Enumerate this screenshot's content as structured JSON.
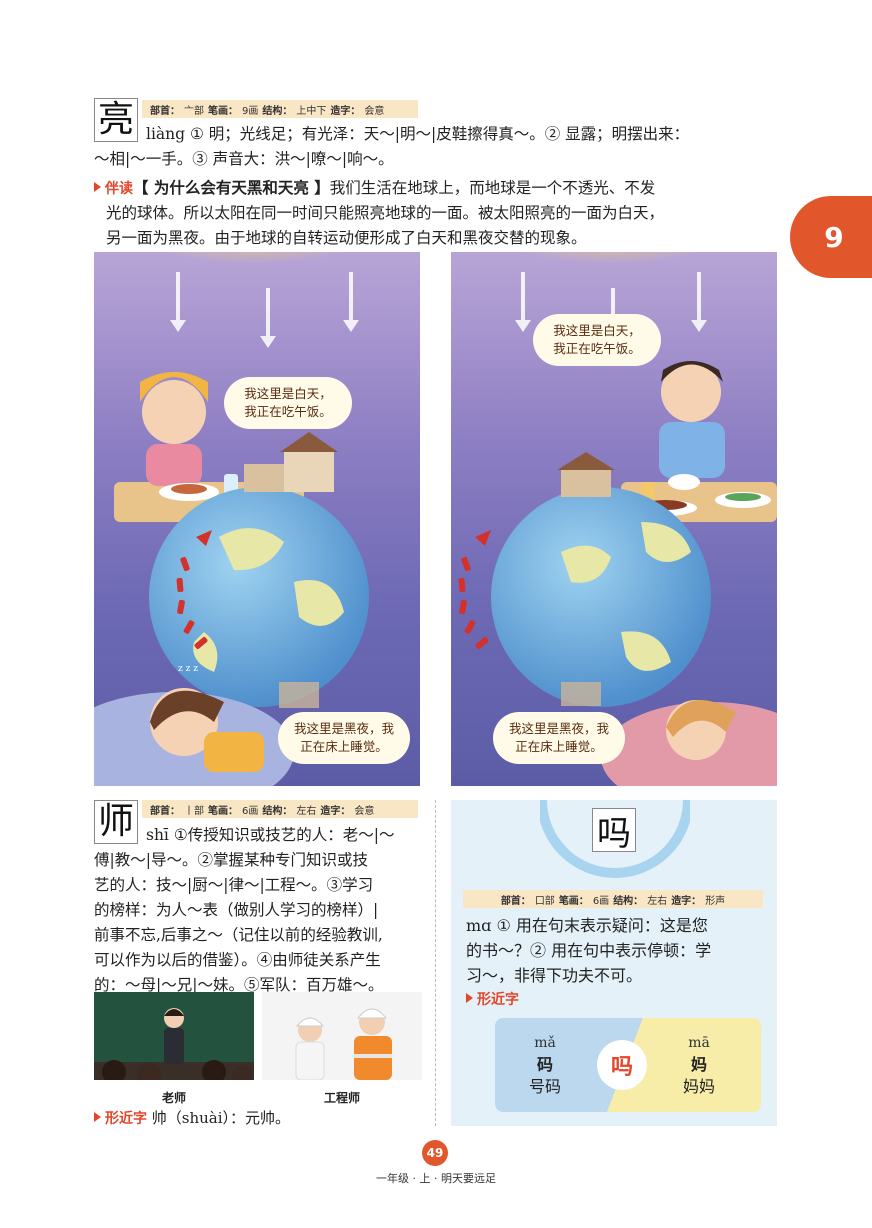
{
  "entries": {
    "liang": {
      "char": "亮",
      "meta": {
        "radical_label": "部首：",
        "radical": "亠部",
        "strokes_label": "笔画：",
        "strokes": "9画",
        "structure_label": "结构：",
        "structure": "上中下",
        "formation_label": "造字：",
        "formation": "会意"
      },
      "line1": "liàng ① 明；光线足；有光泽：天～|明～|皮鞋擦得真～。② 显露；明摆出来：",
      "line2": "～相|～一手。③ 声音大：洪～|嘹～|响～。"
    },
    "shi": {
      "char": "师",
      "meta": {
        "radical_label": "部首：",
        "radical": "丨部",
        "strokes_label": "笔画：",
        "strokes": "6画",
        "structure_label": "结构：",
        "structure": "左右",
        "formation_label": "造字：",
        "formation": "会意"
      },
      "lines": [
        "shī ①传授知识或技艺的人：老～|～",
        "傅|教～|导～。②掌握某种专门知识或技",
        "艺的人：技～|厨～|律～|工程～。③学习",
        "的榜样：为人～表（做别人学习的榜样）|",
        "前事不忘,后事之～（记住以前的经验教训,",
        "可以作为以后的借鉴）。④由师徒关系产生",
        "的：～母|～兄|～妹。⑤军队：百万雄～。"
      ],
      "photos": [
        {
          "caption": "老师"
        },
        {
          "caption": "工程师"
        }
      ],
      "similar_label": "形近字",
      "similar_text": "帅（shuài）：元帅。"
    },
    "ma": {
      "char": "吗",
      "meta": {
        "radical_label": "部首：",
        "radical": "口部",
        "strokes_label": "笔画：",
        "strokes": "6画",
        "structure_label": "结构：",
        "structure": "左右",
        "formation_label": "造字：",
        "formation": "形声"
      },
      "lines": [
        "mɑ ① 用在句末表示疑问：这是您",
        "的书～？② 用在句中表示停顿：学",
        "习～，非得下功夫不可。"
      ],
      "similar_label": "形近字",
      "compare": {
        "left": {
          "pinyin": "mǎ",
          "char": "码",
          "word": "号码"
        },
        "center": "吗",
        "right": {
          "pinyin": "mā",
          "char": "妈",
          "word": "妈妈"
        }
      }
    }
  },
  "reading": {
    "label": "伴读",
    "title": "【 为什么会有天黑和天亮 】",
    "line1_rest": "我们生活在地球上，而地球是一个不透光、不发",
    "line2": "光的球体。所以太阳在同一时间只能照亮地球的一面。被太阳照亮的一面为白天，",
    "line3": "另一面为黑夜。由于地球的自转运动便形成了白天和黑夜交替的现象。"
  },
  "illustrations": {
    "left": {
      "bubble_day": [
        "我这里是白天，",
        "我正在吃午饭。"
      ],
      "bubble_night": [
        "我这里是黑夜，我",
        "正在床上睡觉。"
      ],
      "zzz": "z z z"
    },
    "right": {
      "bubble_day": [
        "我这里是白天，",
        "我正在吃午饭。"
      ],
      "bubble_night": [
        "我这里是黑夜，我",
        "正在床上睡觉。"
      ]
    }
  },
  "lesson_number": "9",
  "page_number": "49",
  "footer": "一年级 · 上 · 明天要远足",
  "colors": {
    "accent": "#e2562c",
    "tag_red": "#e2472b",
    "meta_bg": "#f8e6c4",
    "card_bg": "#e4f1f8"
  }
}
